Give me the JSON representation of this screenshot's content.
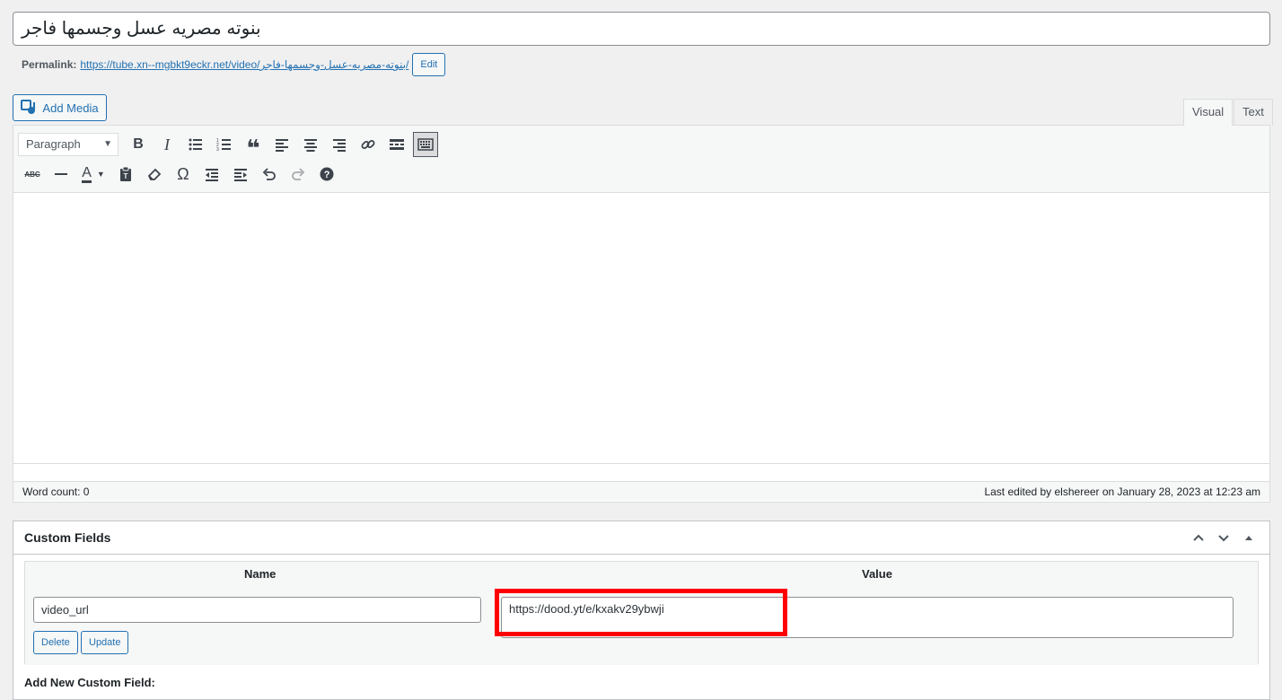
{
  "post": {
    "title": "بنوته مصريه عسل وجسمها فاجر",
    "permalink_label": "Permalink:",
    "permalink_url": "https://tube.xn--mgbkt9eckr.net/video/بنوته-مصريه-عسل-وجسمها-فاجر/",
    "edit_label": "Edit"
  },
  "editor": {
    "add_media_label": "Add Media",
    "tabs": [
      {
        "label": "Visual"
      },
      {
        "label": "Text"
      }
    ],
    "format_select": "Paragraph",
    "word_count": "Word count: 0",
    "last_edited": "Last edited by elshereer on January 28, 2023 at 12:23 am"
  },
  "custom_fields": {
    "title": "Custom Fields",
    "col_name": "Name",
    "col_value": "Value",
    "row": {
      "name": "video_url",
      "value": "https://dood.yt/e/kxakv29ybwji",
      "delete_label": "Delete",
      "update_label": "Update"
    },
    "add_new_label": "Add New Custom Field:"
  },
  "colors": {
    "accent": "#2271b1",
    "highlight": "#ff0000"
  }
}
